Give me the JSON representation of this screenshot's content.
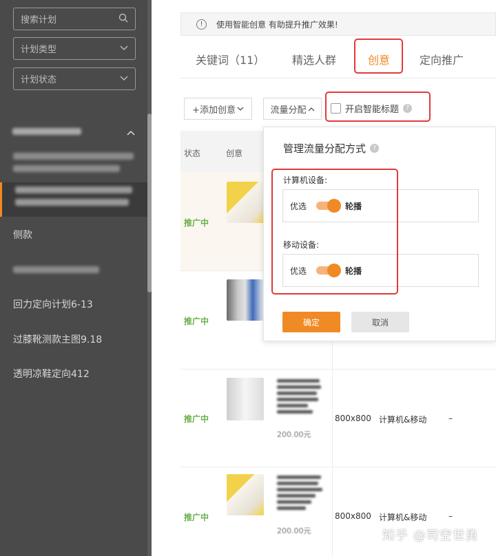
{
  "sidebar": {
    "search_placeholder": "搜索计划",
    "plan_type": "计划类型",
    "plan_status": "计划状态",
    "items": [
      {
        "label": "侧款"
      },
      {
        "label": "回力定向计划6-13"
      },
      {
        "label": "过膝靴测款主图9.18"
      },
      {
        "label": "透明凉鞋定向412"
      }
    ]
  },
  "notice": {
    "text": "使用智能创意 有助提升推广效果!"
  },
  "tabs": [
    {
      "label": "关键词（11）"
    },
    {
      "label": "精选人群"
    },
    {
      "label": "创意"
    },
    {
      "label": "定向推广"
    }
  ],
  "toolbar": {
    "add_creative": "+添加创意",
    "traffic": "流量分配",
    "smart_title": "开启智能标题"
  },
  "table": {
    "headers": {
      "status": "状态",
      "creative": "创意"
    },
    "rows": [
      {
        "status": "推广中",
        "size": "",
        "device": "",
        "extra": "",
        "price": ""
      },
      {
        "status": "推广中",
        "size": "",
        "device": "",
        "extra": "",
        "price": ""
      },
      {
        "status": "推广中",
        "size": "800x800",
        "device": "计算机&移动",
        "extra": "–",
        "price": "200.00元"
      },
      {
        "status": "推广中",
        "size": "800x800",
        "device": "计算机&移动",
        "extra": "–",
        "price": "200.00元"
      }
    ]
  },
  "popover": {
    "title": "管理流量分配方式",
    "pc_label": "计算机设备:",
    "mobile_label": "移动设备:",
    "left_option": "优选",
    "right_option": "轮播",
    "ok": "确定",
    "cancel": "取消"
  },
  "watermark": "知乎 @司空世勇",
  "colors": {
    "accent": "#f08a24",
    "highlight": "#e03a3a",
    "status_green": "#6ab04c"
  }
}
